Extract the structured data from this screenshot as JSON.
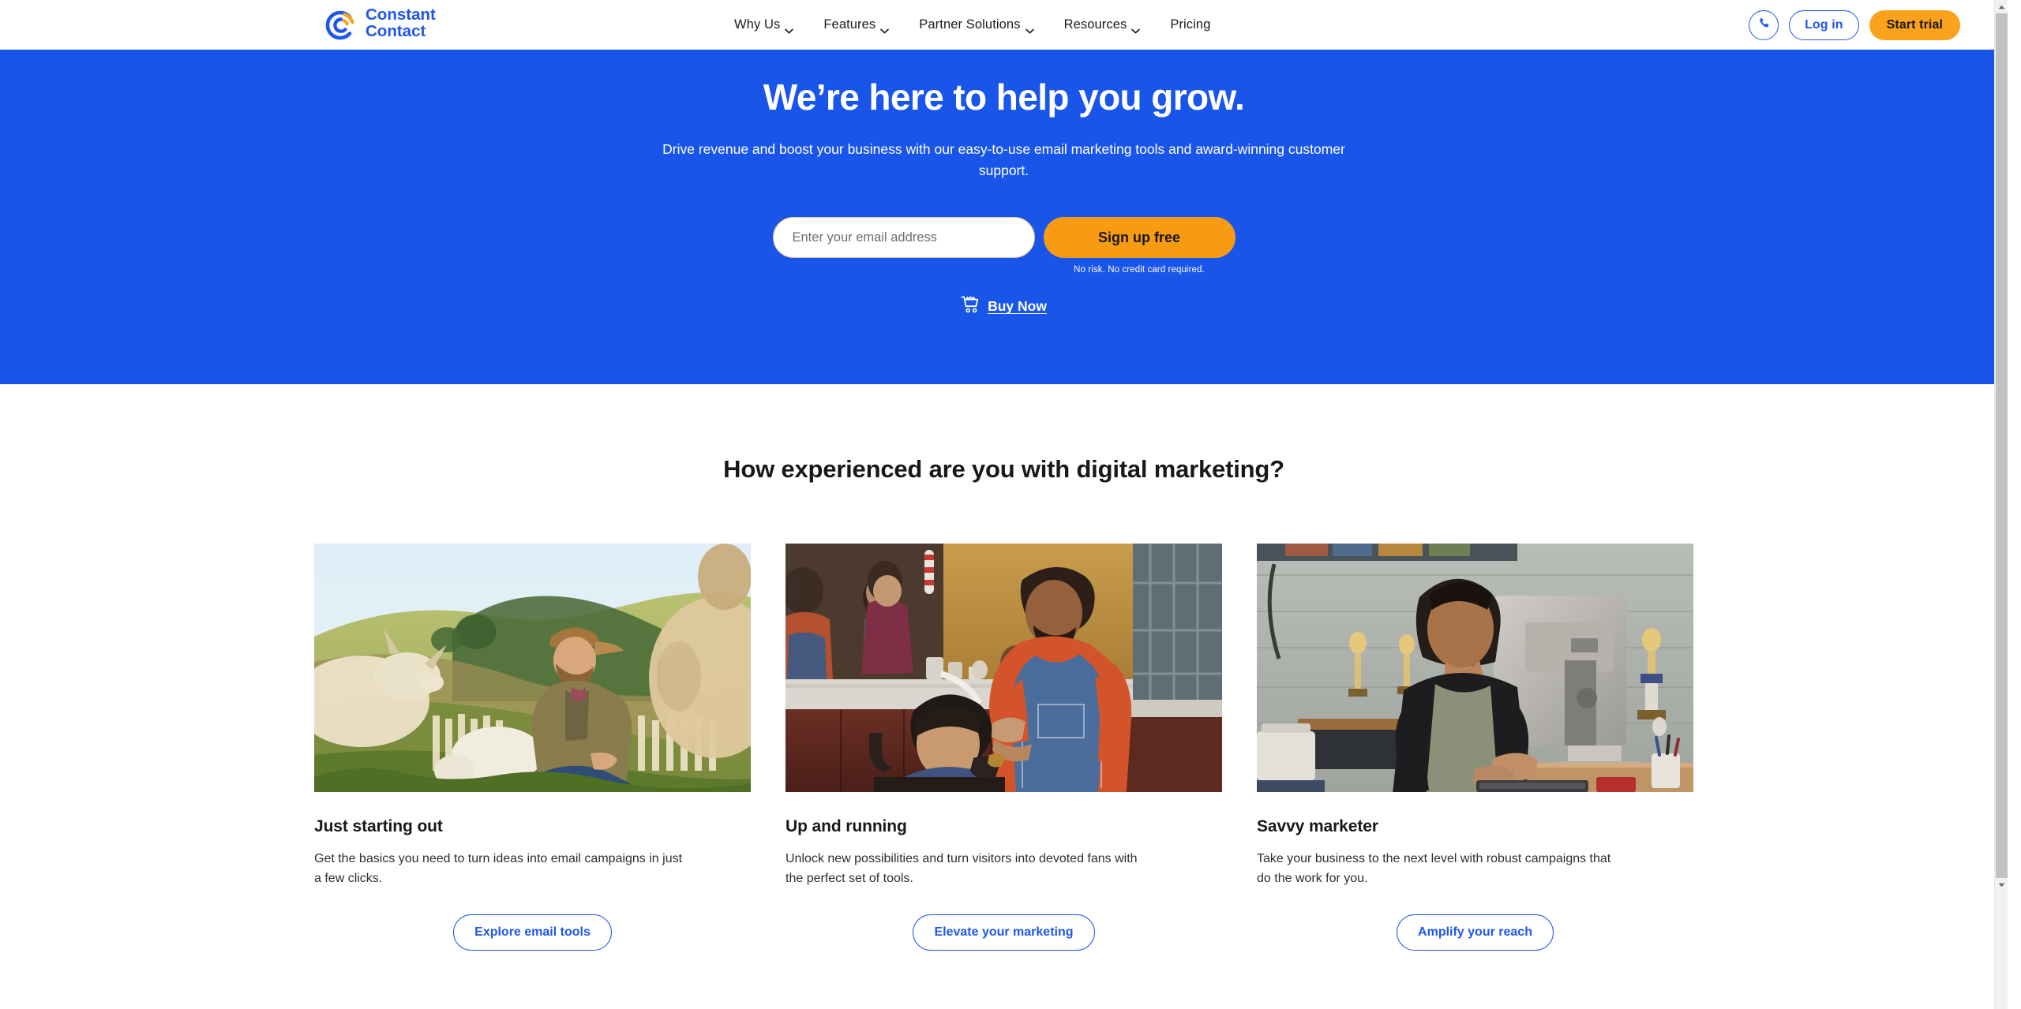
{
  "brand": {
    "name_line1": "Constant",
    "name_line2": "Contact",
    "blue": "#1a55ea",
    "link_blue": "#1f56ec",
    "orange": "#f79c12",
    "trial_orange": "#faa21b",
    "logo_icon": "constant-contact-logo"
  },
  "header": {
    "nav": [
      {
        "label": "Why Us",
        "has_dropdown": true
      },
      {
        "label": "Features",
        "has_dropdown": true
      },
      {
        "label": "Partner Solutions",
        "has_dropdown": true
      },
      {
        "label": "Resources",
        "has_dropdown": true
      },
      {
        "label": "Pricing",
        "has_dropdown": false
      }
    ],
    "phone_icon": "phone-icon",
    "login_label": "Log in",
    "trial_label": "Start trial"
  },
  "hero": {
    "title": "We’re here to help you grow.",
    "subtitle": "Drive revenue and boost your business with our easy-to-use email marketing tools and award-winning customer support.",
    "email_placeholder": "Enter your email address",
    "email_value": "",
    "signup_label": "Sign up free",
    "disclaimer": "No risk. No credit card required.",
    "buy_now_label": "Buy Now",
    "cart_icon": "shopping-cart-icon"
  },
  "experience": {
    "heading": "How experienced are you with digital marketing?",
    "cards": [
      {
        "image_alt": "man-with-goats-on-farm-photo",
        "title": "Just starting out",
        "description": "Get the basics you need to turn ideas into email campaigns in just a few clicks.",
        "cta": "Explore email tools"
      },
      {
        "image_alt": "barber-cutting-boys-hair-photo",
        "title": "Up and running",
        "description": "Unlock new possibilities and turn visitors into devoted fans with the perfect set of tools.",
        "cta": "Elevate your marketing"
      },
      {
        "image_alt": "woman-working-at-computer-photo",
        "title": "Savvy marketer",
        "description": "Take your business to the next level with robust campaigns that do the work for you.",
        "cta": "Amplify your reach"
      }
    ]
  },
  "scrollbar": {
    "up_arrow_icon": "scroll-up-arrow-icon",
    "down_arrow_icon": "scroll-down-arrow-icon"
  }
}
